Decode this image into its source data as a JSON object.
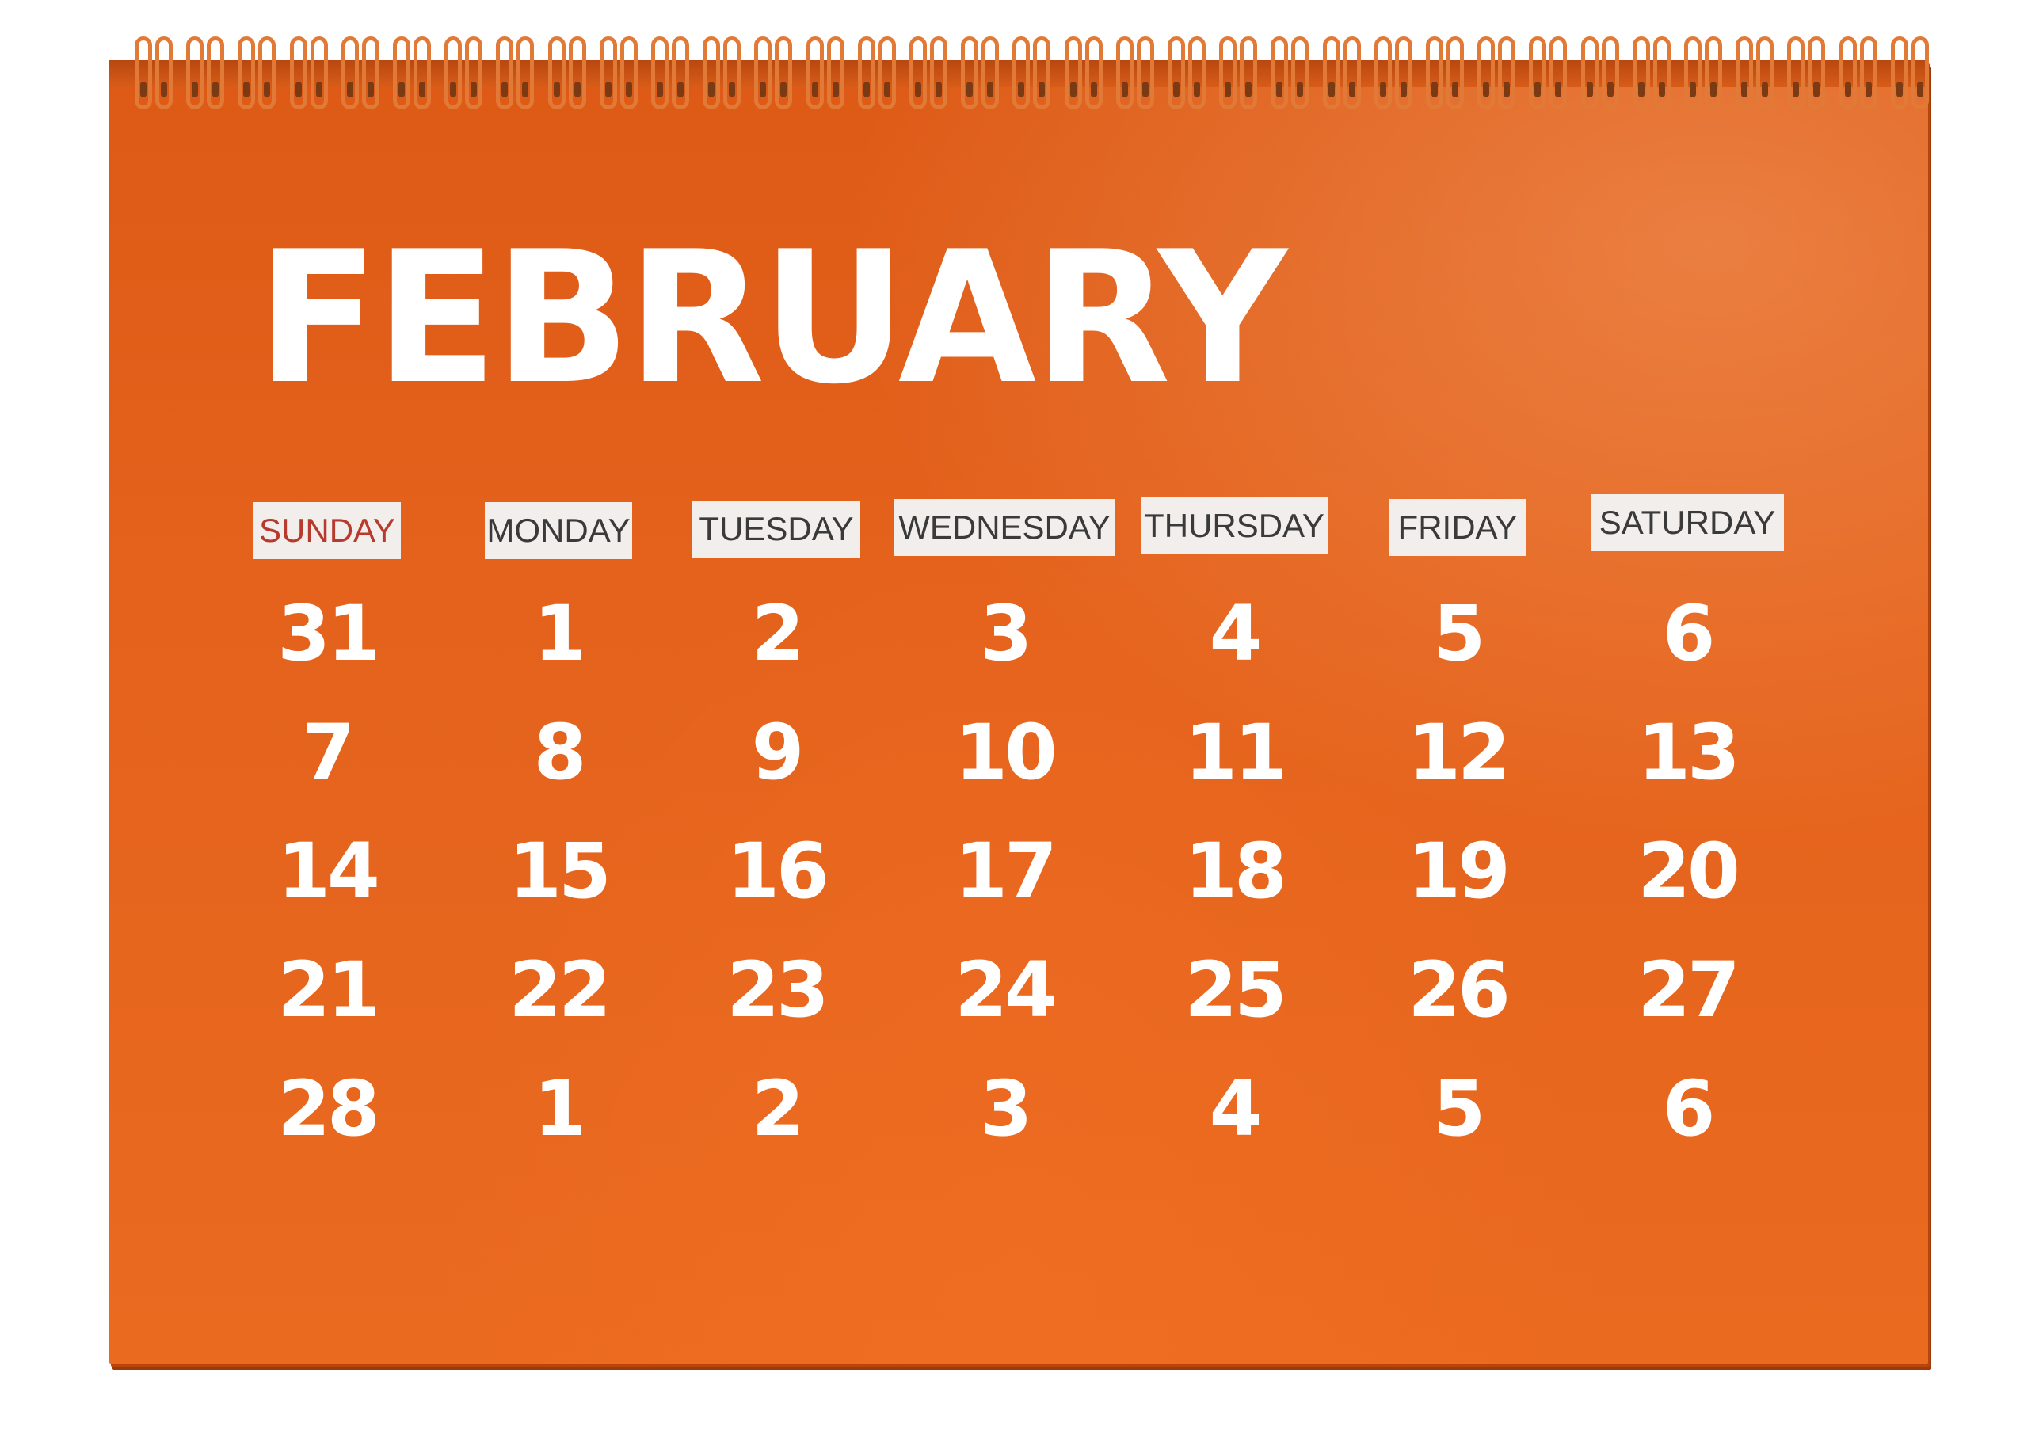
{
  "colors": {
    "calendar_page": "#e2601b",
    "weekday_label_bg": "#f1eeec",
    "weekday_text": "#3a3a3a",
    "sunday_text": "#b83a2c",
    "numbers": "#ffffff"
  },
  "calendar": {
    "month": "FEBRUARY",
    "weekdays": [
      "SUNDAY",
      "MONDAY",
      "TUESDAY",
      "WEDNESDAY",
      "THURSDAY",
      "FRIDAY",
      "SATURDAY"
    ],
    "weeks": [
      [
        "31",
        "1",
        "2",
        "3",
        "4",
        "5",
        "6"
      ],
      [
        "7",
        "8",
        "9",
        "10",
        "11",
        "12",
        "13"
      ],
      [
        "14",
        "15",
        "16",
        "17",
        "18",
        "19",
        "20"
      ],
      [
        "21",
        "22",
        "23",
        "24",
        "25",
        "26",
        "27"
      ],
      [
        "28",
        "1",
        "2",
        "3",
        "4",
        "5",
        "6"
      ]
    ]
  }
}
